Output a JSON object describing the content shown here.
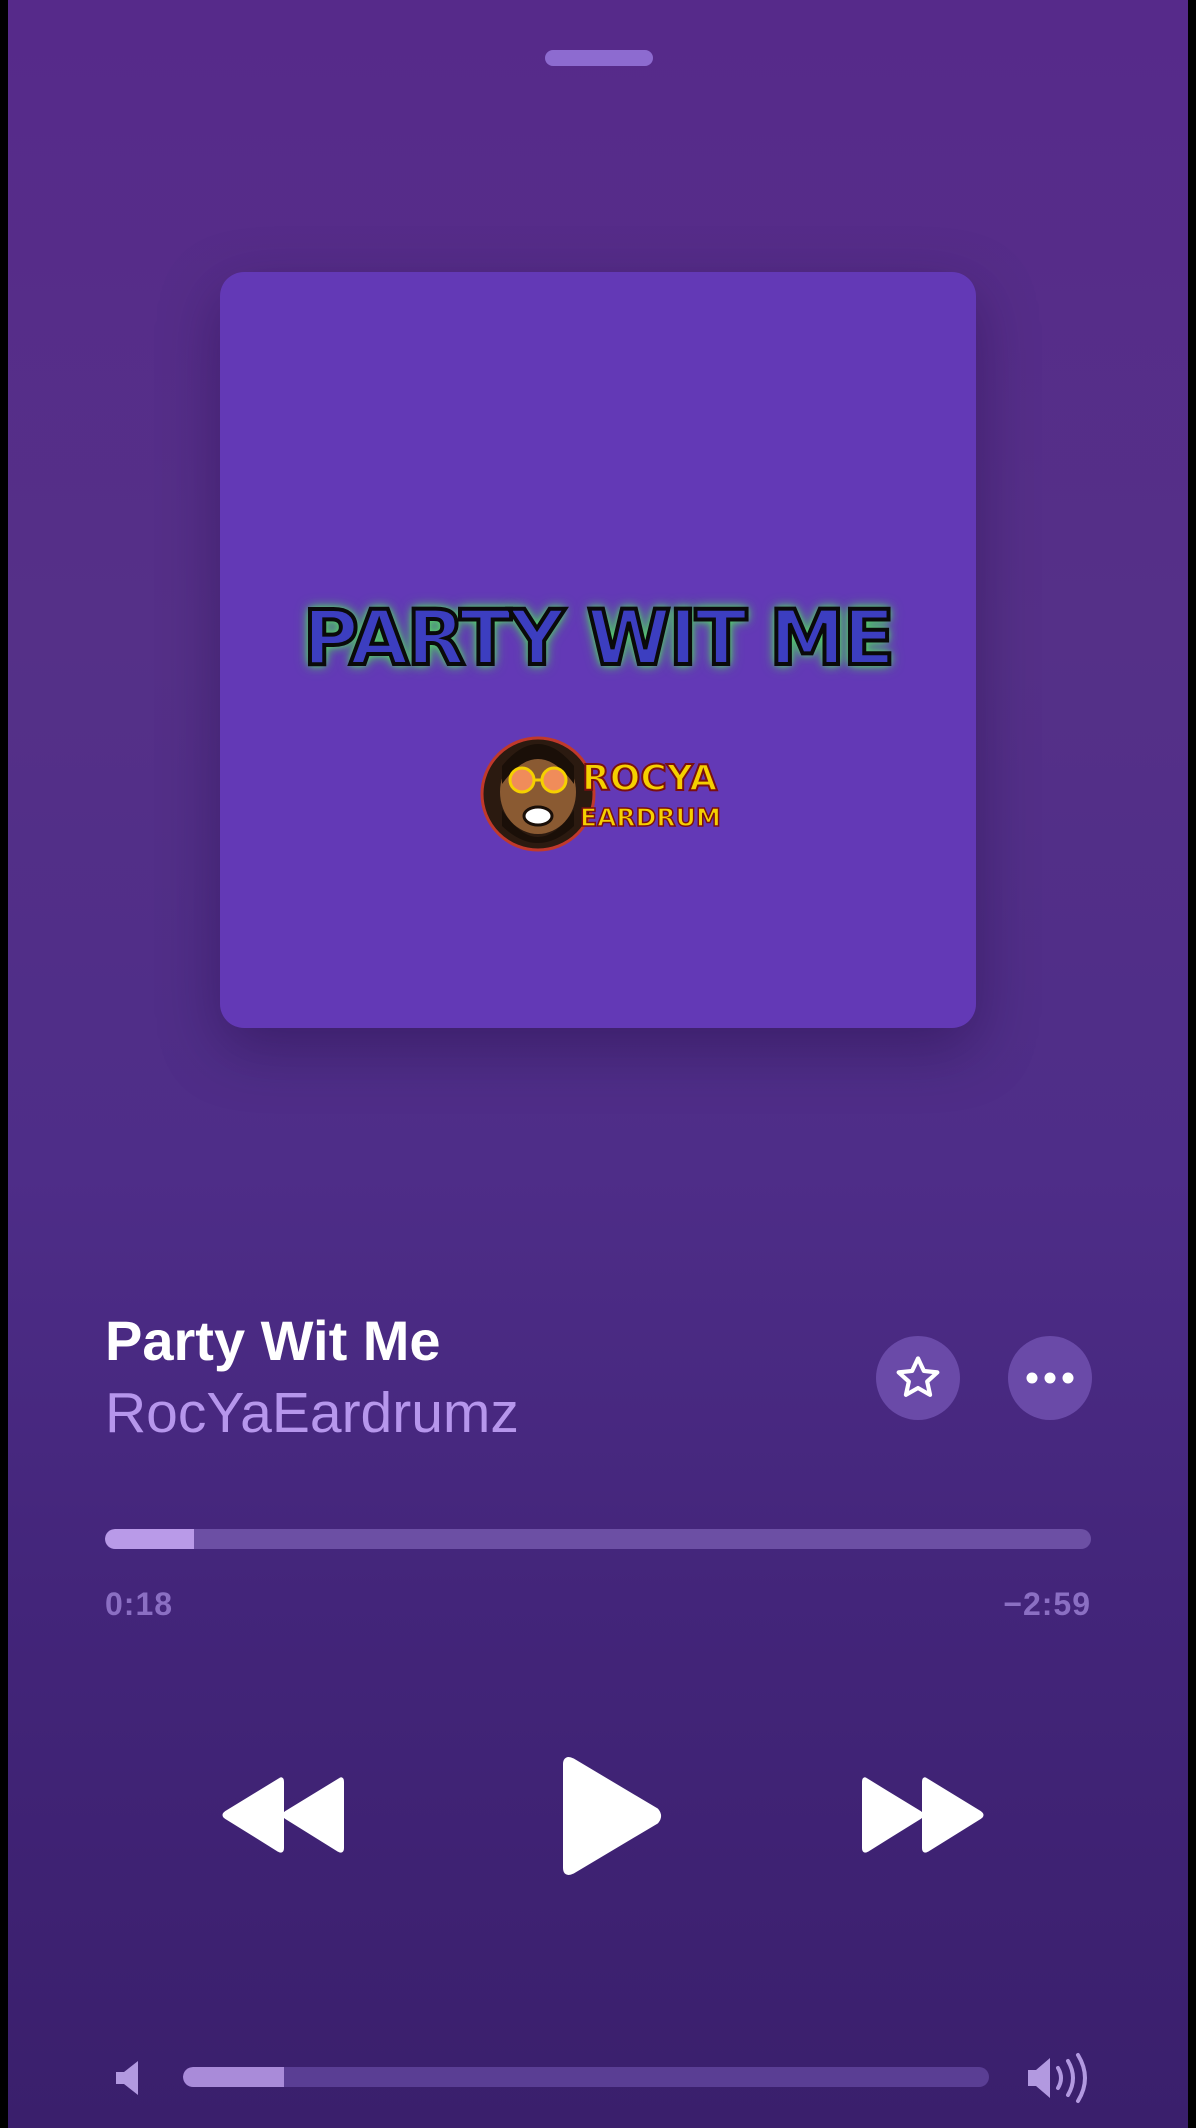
{
  "now_playing": {
    "title": "Party Wit Me",
    "artist": "RocYaEardrumz",
    "artwork": {
      "title_text": "PARTY WIT ME",
      "logo_line1": "ROCYA",
      "logo_line2": "EARDRUMZ"
    }
  },
  "playback": {
    "elapsed": "0:18",
    "remaining": "−2:59",
    "progress_fraction": 0.09,
    "state": "paused"
  },
  "volume": {
    "level_fraction": 0.125
  },
  "actions": {
    "favorite_icon": "star-icon",
    "more_icon": "ellipsis-icon"
  },
  "colors": {
    "background_top": "#562a8a",
    "background_bottom": "#3a1f6c",
    "artwork_bg": "#6339b6",
    "accent": "#b99ae8",
    "artist_text": "#b696ec"
  }
}
